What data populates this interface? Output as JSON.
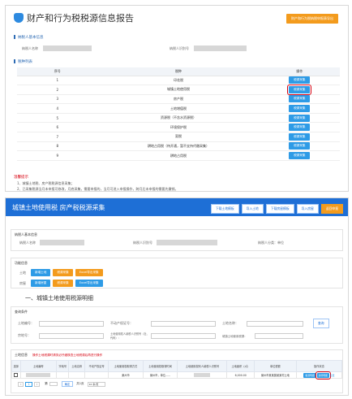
{
  "panel1": {
    "title": "财产和行为税税源信息报告",
    "top_button": "财产和行为税纳税申报表导出",
    "sec_basic": "纳税人基本信息",
    "label_name": "纳税人名称",
    "label_id": "纳税人识别号",
    "sec_list": "税种列表",
    "columns": [
      "序号",
      "税种",
      "操作"
    ],
    "rows": [
      {
        "no": "1",
        "tax": "印花税",
        "op": "税源采集"
      },
      {
        "no": "2",
        "tax": "城镇土地使用税",
        "op": "税源采集"
      },
      {
        "no": "3",
        "tax": "房产税",
        "op": "税源采集"
      },
      {
        "no": "4",
        "tax": "土地增值税",
        "op": "税源采集"
      },
      {
        "no": "5",
        "tax": "资源税（不含水资源税）",
        "op": "税源采集"
      },
      {
        "no": "6",
        "tax": "环境保护税",
        "op": "税源采集"
      },
      {
        "no": "7",
        "tax": "契税",
        "op": "税源采集"
      },
      {
        "no": "8",
        "tax": "耕地占用税（待开通，暂不支持代缴采集）",
        "op": "税源采集"
      },
      {
        "no": "9",
        "tax": "耕地占用税",
        "op": "税源采集"
      }
    ],
    "tips_title": "温馨提示",
    "tips": [
      "1、城镇土地税、房产税税源信息采集；",
      "2、已采集税源当月未申报可修改，月底采集，需要申报的，当月可进入申报操作，跨月后未申报的需要先撤销。"
    ]
  },
  "panel2": {
    "title": "城镇土地使用税 房产税税源采集",
    "tabs": [
      "下载土地模板",
      "导入土地",
      "下载房屋模板",
      "导入房屋",
      "返回申报"
    ],
    "sec_basic": "纳税人基本信息",
    "label_name": "纳税人名称",
    "label_id": "纳税人识别号",
    "label_type": "纳税人分类：",
    "type_value": "单位",
    "sec_func": "功能信息",
    "row1_label": "土地",
    "row2_label": "房屋",
    "btn_add": "新增土地",
    "btn_tax": "税源采集",
    "btn_excel": "Excel导出采集",
    "btn_add2": "新增房屋",
    "btn_tax2": "税源采集",
    "btn_excel2": "Excel导出采集",
    "heading": "一、城镇土地使用税源明细",
    "sec_query": "查询条件",
    "q_land_no": "土地编号：",
    "q_prop_no": "不动产权证号：",
    "q_land_name": "土地名称：",
    "q_search": "查询",
    "q_plot": "宗地号：",
    "q_owner": "土地使用权人纳税人识别号（社、代码）：",
    "q_type": "城镇土地使用税源：",
    "sec_table": "土地信息",
    "table_hint": "操作土地税源时请务必仔细核查土地税源后再进行操作",
    "cols": [
      "选择",
      "土地编号",
      "宗地号",
      "土地名称",
      "不动产权证号",
      "土地使用权取得方式",
      "土地使用权取得时间",
      "土地使用权利人纳税人识别号",
      "土地面积（㎡）",
      "单位税额",
      "操作状态"
    ],
    "row": {
      "area": "6,000.00",
      "loc": "莱州市",
      "tax_area": "莱州市，单位……",
      "info": "莱州市某某镇某某村土地"
    },
    "op1": "税源明细",
    "op2": "新增明细",
    "op3": "变更"
  },
  "pager": {
    "page_label": "第",
    "page_of": "共1页",
    "go": "确定",
    "per": "10 条/页",
    "total": "1",
    "current": "1"
  }
}
